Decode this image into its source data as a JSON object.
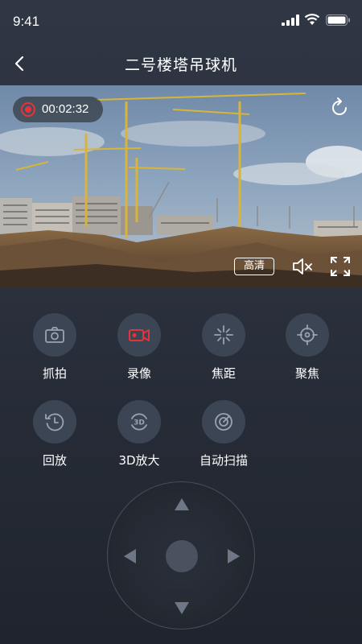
{
  "status_bar": {
    "time": "9:41"
  },
  "nav": {
    "title": "二号楼塔吊球机"
  },
  "video": {
    "recording_time": "00:02:32",
    "quality_label": "高清"
  },
  "controls": {
    "row1": [
      {
        "label": "抓拍",
        "icon": "camera-icon"
      },
      {
        "label": "录像",
        "icon": "video-record-icon"
      },
      {
        "label": "焦距",
        "icon": "focal-length-icon"
      },
      {
        "label": "聚焦",
        "icon": "focus-crosshair-icon"
      }
    ],
    "row2": [
      {
        "label": "回放",
        "icon": "playback-icon"
      },
      {
        "label": "3D放大",
        "icon": "3d-zoom-icon"
      },
      {
        "label": "自动扫描",
        "icon": "auto-scan-icon"
      }
    ]
  },
  "colors": {
    "background": "#2a303c",
    "button_bg": "#3c4553",
    "record_red": "#e5333b",
    "icon_gray": "#9aa3b0"
  }
}
